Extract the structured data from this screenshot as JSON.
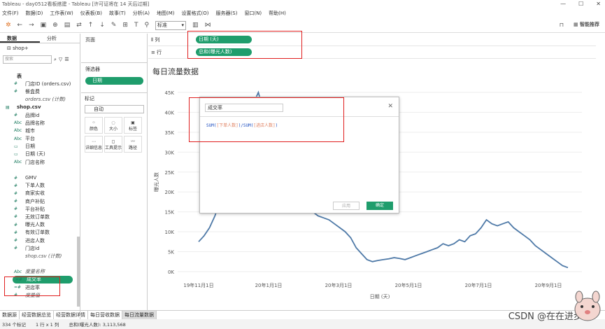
{
  "title": "Tableau - day0512看板搭建 - Tableau [许可证将在 14 天后过期]",
  "menu": [
    "文件(F)",
    "数据(D)",
    "工作表(W)",
    "仪表板(B)",
    "故事(T)",
    "分析(A)",
    "地图(M)",
    "设置格式(O)",
    "服务器(S)",
    "窗口(N)",
    "帮助(H)"
  ],
  "toolbar": {
    "fit": "标准",
    "smart": "智能推荐"
  },
  "left": {
    "tabs": [
      "数据",
      "分析"
    ],
    "datasource": "shop+",
    "search_placeholder": "搜索",
    "fields": [
      {
        "icon": "",
        "label": "表",
        "cls": "sec"
      },
      {
        "icon": "#",
        "label": "门店ID (orders.csv)"
      },
      {
        "icon": "#",
        "label": "餐盒费"
      },
      {
        "icon": "",
        "label": "orders.csv (计数)",
        "cls": "ital"
      },
      {
        "icon": "▤",
        "label": "shop.csv",
        "cls": "sec"
      },
      {
        "icon": "#",
        "label": "品牌id"
      },
      {
        "icon": "Abc",
        "label": "品牌名称"
      },
      {
        "icon": "Abc",
        "label": "城市"
      },
      {
        "icon": "Abc",
        "label": "平台"
      },
      {
        "icon": "▭",
        "label": "日期"
      },
      {
        "icon": "▭",
        "label": "日期 (天)"
      },
      {
        "icon": "Abc",
        "label": "门店名称"
      },
      {
        "icon": "",
        "label": ""
      },
      {
        "icon": "#",
        "label": "GMV"
      },
      {
        "icon": "#",
        "label": "下单人数"
      },
      {
        "icon": "#",
        "label": "商家实收"
      },
      {
        "icon": "#",
        "label": "商户补贴"
      },
      {
        "icon": "#",
        "label": "平台补贴"
      },
      {
        "icon": "#",
        "label": "无效订单数"
      },
      {
        "icon": "#",
        "label": "曝光人数"
      },
      {
        "icon": "#",
        "label": "有效订单数"
      },
      {
        "icon": "#",
        "label": "进店人数"
      },
      {
        "icon": "#",
        "label": "门店id"
      },
      {
        "icon": "",
        "label": "shop.csv (计数)",
        "cls": "ital"
      },
      {
        "icon": "",
        "label": ""
      },
      {
        "icon": "Abc",
        "label": "度量名称",
        "cls": "ital"
      },
      {
        "icon": "=#",
        "label": "成交率",
        "cls": "pill"
      },
      {
        "icon": "=#",
        "label": "进店率"
      },
      {
        "icon": "#",
        "label": "度量值",
        "cls": "ital"
      }
    ]
  },
  "mid": {
    "pages": "页面",
    "filters": "筛选器",
    "filter_pill": "日期",
    "marks": "标记",
    "mark_type": "自动",
    "mark_buttons": [
      "颜色",
      "大小",
      "标签",
      "详细信息",
      "工具提示",
      "路径"
    ]
  },
  "shelves": {
    "columns_label": "列",
    "columns_pill": "日期 (天)",
    "rows_label": "行",
    "rows_pill": "总和(曝光人数)"
  },
  "chart_data": {
    "type": "line",
    "title": "每日流量数据",
    "xlabel": "日期 (天)",
    "ylabel": "曝光人数",
    "ylim": [
      0,
      45000
    ],
    "yticks": [
      "0K",
      "5K",
      "10K",
      "15K",
      "20K",
      "25K",
      "30K",
      "35K",
      "40K",
      "45K"
    ],
    "xticks": [
      "19年11月1日",
      "20年1月1日",
      "20年3月1日",
      "20年5月1日",
      "20年7月1日",
      "20年9月1日"
    ],
    "series": [
      {
        "values": [
          7500,
          9000,
          11000,
          14000,
          18000,
          22000,
          26000,
          30000,
          34000,
          38000,
          42000,
          45000,
          40000,
          36000,
          32000,
          28000,
          24000,
          21000,
          19000,
          17000,
          16000,
          15000,
          14000,
          13500,
          13000,
          12000,
          11000,
          10000,
          8500,
          6000,
          4500,
          3000,
          2500,
          2800,
          3000,
          3200,
          3500,
          3300,
          3000,
          3500,
          4000,
          4500,
          5000,
          5500,
          6000,
          7000,
          6500,
          7000,
          8000,
          7500,
          9000,
          9500,
          11000,
          13000,
          12000,
          11500,
          12000,
          12500,
          11000,
          10000,
          9000,
          8000,
          6500,
          5500,
          4500,
          3500,
          2500,
          1500,
          1000
        ]
      }
    ]
  },
  "dialog": {
    "name": "成交率",
    "formula_a": "SUM(",
    "formula_b": "[下单人数]",
    "formula_c": ")/SUM(",
    "formula_d": "[进店人数]",
    "formula_e": ")",
    "apply": "应用",
    "ok": "确定"
  },
  "sheets": [
    "数据源",
    "经营数据总览",
    "经营数据详情",
    "每日营收数据",
    "每日流量数据"
  ],
  "status": {
    "marks": "334 个标记",
    "rows": "1 行 x 1 列",
    "sum": "总和(曝光人数): 3,113,568"
  },
  "watermark": "CSDN @在在进步"
}
